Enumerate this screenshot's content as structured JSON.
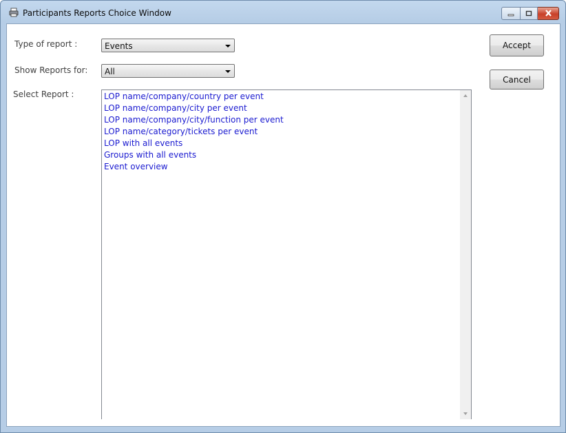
{
  "window": {
    "title": "Participants Reports Choice Window"
  },
  "form": {
    "type_label": "Type of report :",
    "type_value": "Events",
    "show_label": "Show Reports for:",
    "show_value": "All",
    "select_label": "Select Report :"
  },
  "reports": [
    "LOP name/company/country per event",
    "LOP name/company/city per event",
    "LOP name/company/city/function per event",
    "LOP name/category/tickets per event",
    "LOP with all events",
    "Groups with all events",
    "Event overview"
  ],
  "buttons": {
    "accept": "Accept",
    "cancel": "Cancel"
  },
  "icons": {
    "app": "printer-icon",
    "minimize": "minimize-icon",
    "maximize": "maximize-icon",
    "close": "close-icon"
  }
}
